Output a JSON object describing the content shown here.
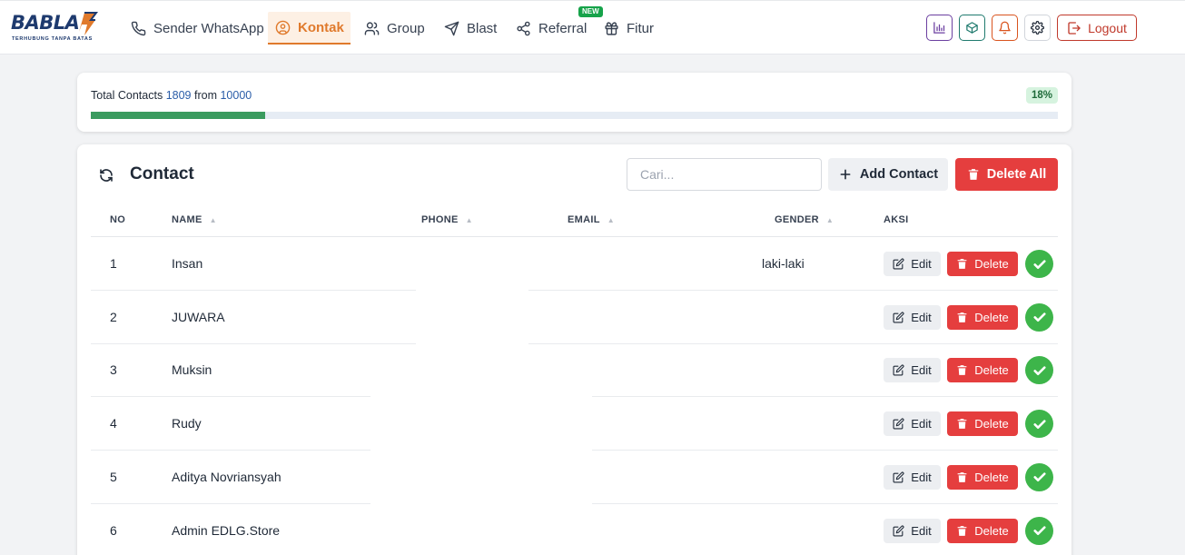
{
  "brand": {
    "name": "BABLAST",
    "word_part": "BABLA",
    "tagline": "TERHUBUNG TANPA BATAS"
  },
  "nav": {
    "items": [
      {
        "label": "Sender WhatsApp",
        "icon": "phone-icon"
      },
      {
        "label": "Kontak",
        "icon": "user-circle-icon",
        "active": true
      },
      {
        "label": "Group",
        "icon": "users-icon"
      },
      {
        "label": "Blast",
        "icon": "send-icon"
      },
      {
        "label": "Referral",
        "icon": "share-icon",
        "badge": "NEW"
      },
      {
        "label": "Fitur",
        "icon": "gift-icon"
      }
    ],
    "actions": {
      "stats_icon": "bar-chart-icon",
      "package_icon": "package-icon",
      "bell_icon": "bell-icon",
      "settings_icon": "gear-icon",
      "logout_label": "Logout"
    }
  },
  "summary": {
    "prefix": "Total Contacts",
    "count": "1809",
    "middle": "from",
    "limit": "10000",
    "percent_label": "18%",
    "progress_fraction": 0.18
  },
  "contacts": {
    "title": "Contact",
    "search_placeholder": "Cari...",
    "add_label": "Add Contact",
    "delete_all_label": "Delete All",
    "columns": {
      "no": "NO",
      "name": "NAME",
      "phone": "PHONE",
      "email": "EMAIL",
      "gender": "GENDER",
      "aksi": "AKSI"
    },
    "row_edit_label": "Edit",
    "row_delete_label": "Delete",
    "rows": [
      {
        "no": "1",
        "name": "Insan",
        "phone": "",
        "email": "",
        "gender": "laki-laki"
      },
      {
        "no": "2",
        "name": "JUWARA",
        "phone": "",
        "email": "",
        "gender": ""
      },
      {
        "no": "3",
        "name": "Muksin",
        "phone": "",
        "email": "",
        "gender": ""
      },
      {
        "no": "4",
        "name": "Rudy",
        "phone": "",
        "email": "",
        "gender": ""
      },
      {
        "no": "5",
        "name": "Aditya Novriansyah",
        "phone": "",
        "email": "",
        "gender": ""
      },
      {
        "no": "6",
        "name": "Admin EDLG.Store",
        "phone": "",
        "email": "",
        "gender": ""
      }
    ]
  },
  "colors": {
    "accent": "#e07a2c",
    "brand_navy": "#1e3a6e",
    "danger": "#e53e3e",
    "success": "#3db54a",
    "progress": "#3a9b5f",
    "link_blue": "#2b5da8"
  }
}
